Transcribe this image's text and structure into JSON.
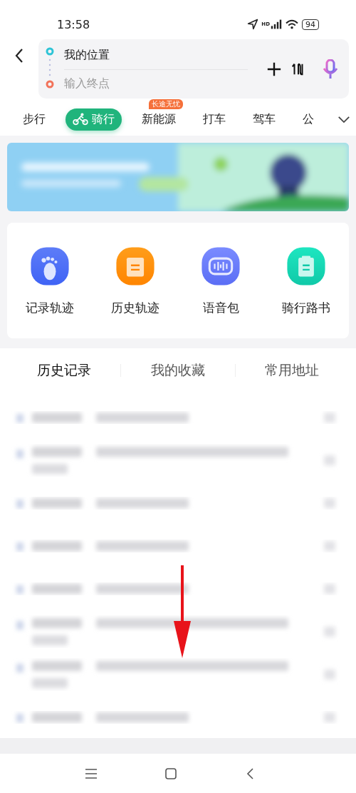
{
  "status_bar": {
    "time": "13:58",
    "network_label": "HD",
    "battery": "94"
  },
  "route": {
    "origin": "我的位置",
    "destination_placeholder": "输入终点"
  },
  "modes": [
    {
      "label": "步行",
      "selected": false
    },
    {
      "label": "骑行",
      "selected": true,
      "kind": "bike"
    },
    {
      "label": "新能源",
      "selected": false,
      "badge": "长途无忧"
    },
    {
      "label": "打车",
      "selected": false
    },
    {
      "label": "驾车",
      "selected": false
    },
    {
      "label": "公",
      "selected": false
    }
  ],
  "tools": [
    {
      "label": "记录轨迹",
      "kind": "foot"
    },
    {
      "label": "历史轨迹",
      "kind": "note"
    },
    {
      "label": "语音包",
      "kind": "voice"
    },
    {
      "label": "骑行路书",
      "kind": "clip"
    }
  ],
  "list_tabs": [
    {
      "label": "历史记录",
      "selected": true
    },
    {
      "label": "我的收藏",
      "selected": false
    },
    {
      "label": "常用地址",
      "selected": false
    }
  ],
  "history_rows": [
    {
      "kind": "short"
    },
    {
      "kind": "long"
    },
    {
      "kind": "short"
    },
    {
      "kind": "short"
    },
    {
      "kind": "short"
    },
    {
      "kind": "long"
    },
    {
      "kind": "long"
    },
    {
      "kind": "short"
    }
  ],
  "annotation": {
    "kind": "arrow"
  }
}
